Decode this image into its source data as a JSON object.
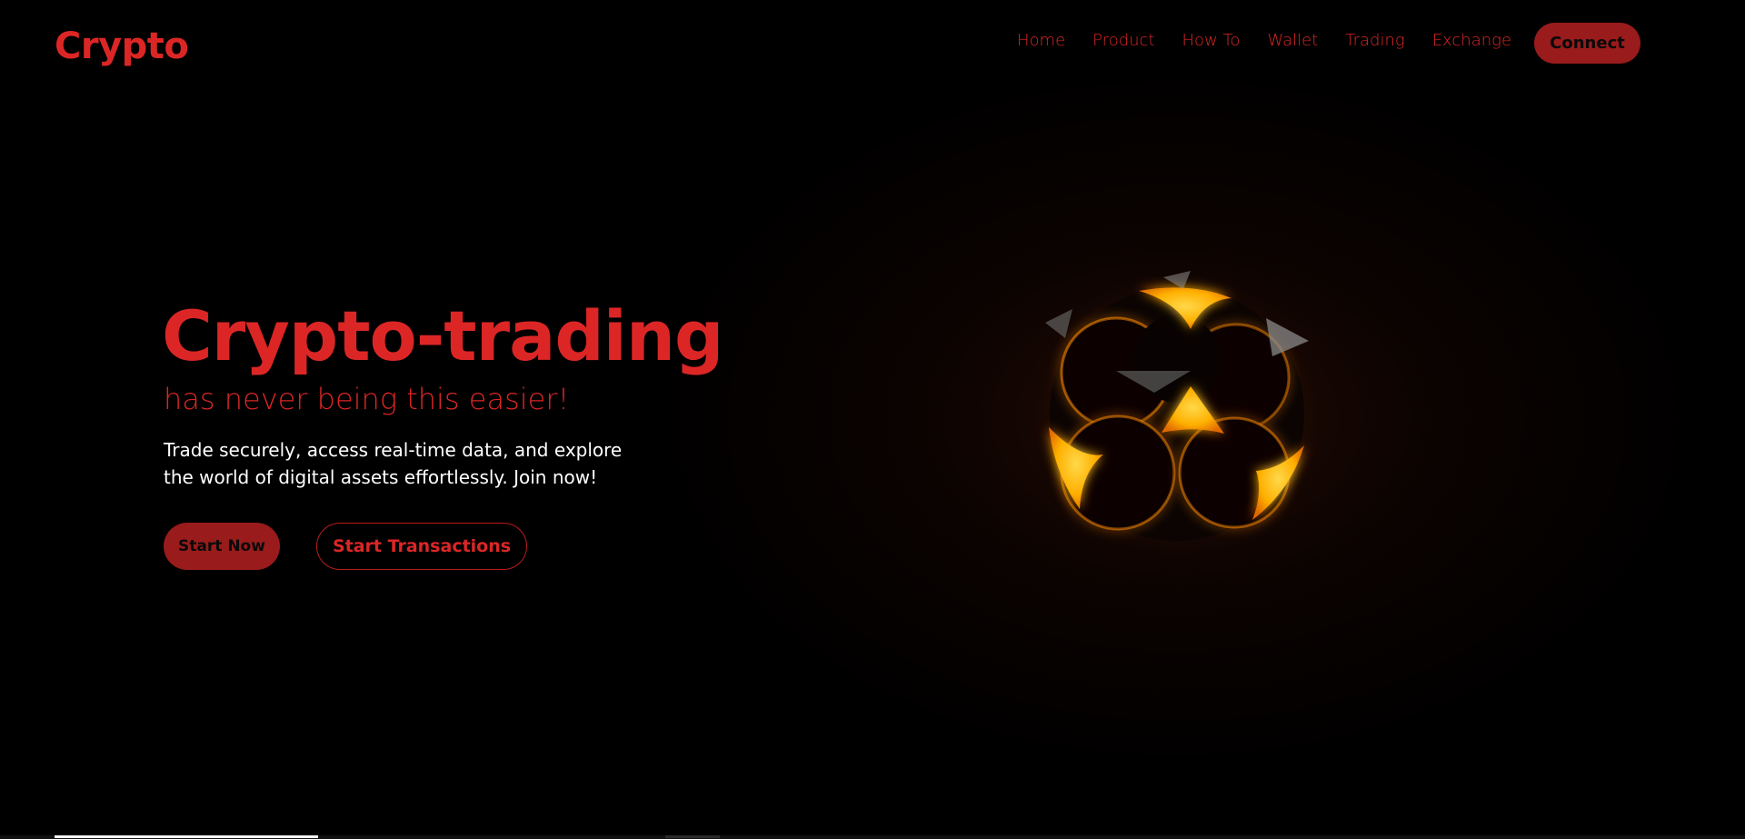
{
  "brand": {
    "logo_text": "Crypto",
    "accent_color": "#dc2626",
    "button_color": "#991b1b"
  },
  "nav": {
    "items": [
      {
        "label": "Home"
      },
      {
        "label": "Product"
      },
      {
        "label": "How To"
      },
      {
        "label": "Wallet"
      },
      {
        "label": "Trading"
      },
      {
        "label": "Exchange"
      }
    ],
    "connect_label": "Connect"
  },
  "hero": {
    "title": "Crypto-trading",
    "subtitle": "has never being this easier!",
    "description_line1": "Trade securely, access real-time data, and explore",
    "description_line2": "the world of digital assets effortlessly. Join now!",
    "primary_button": "Start Now",
    "secondary_button": "Start Transactions"
  },
  "visual": {
    "icon": "glowing-crypto-orb-icon",
    "glow_color": "#fbbf24"
  },
  "progress": {
    "fraction": 0.151
  }
}
